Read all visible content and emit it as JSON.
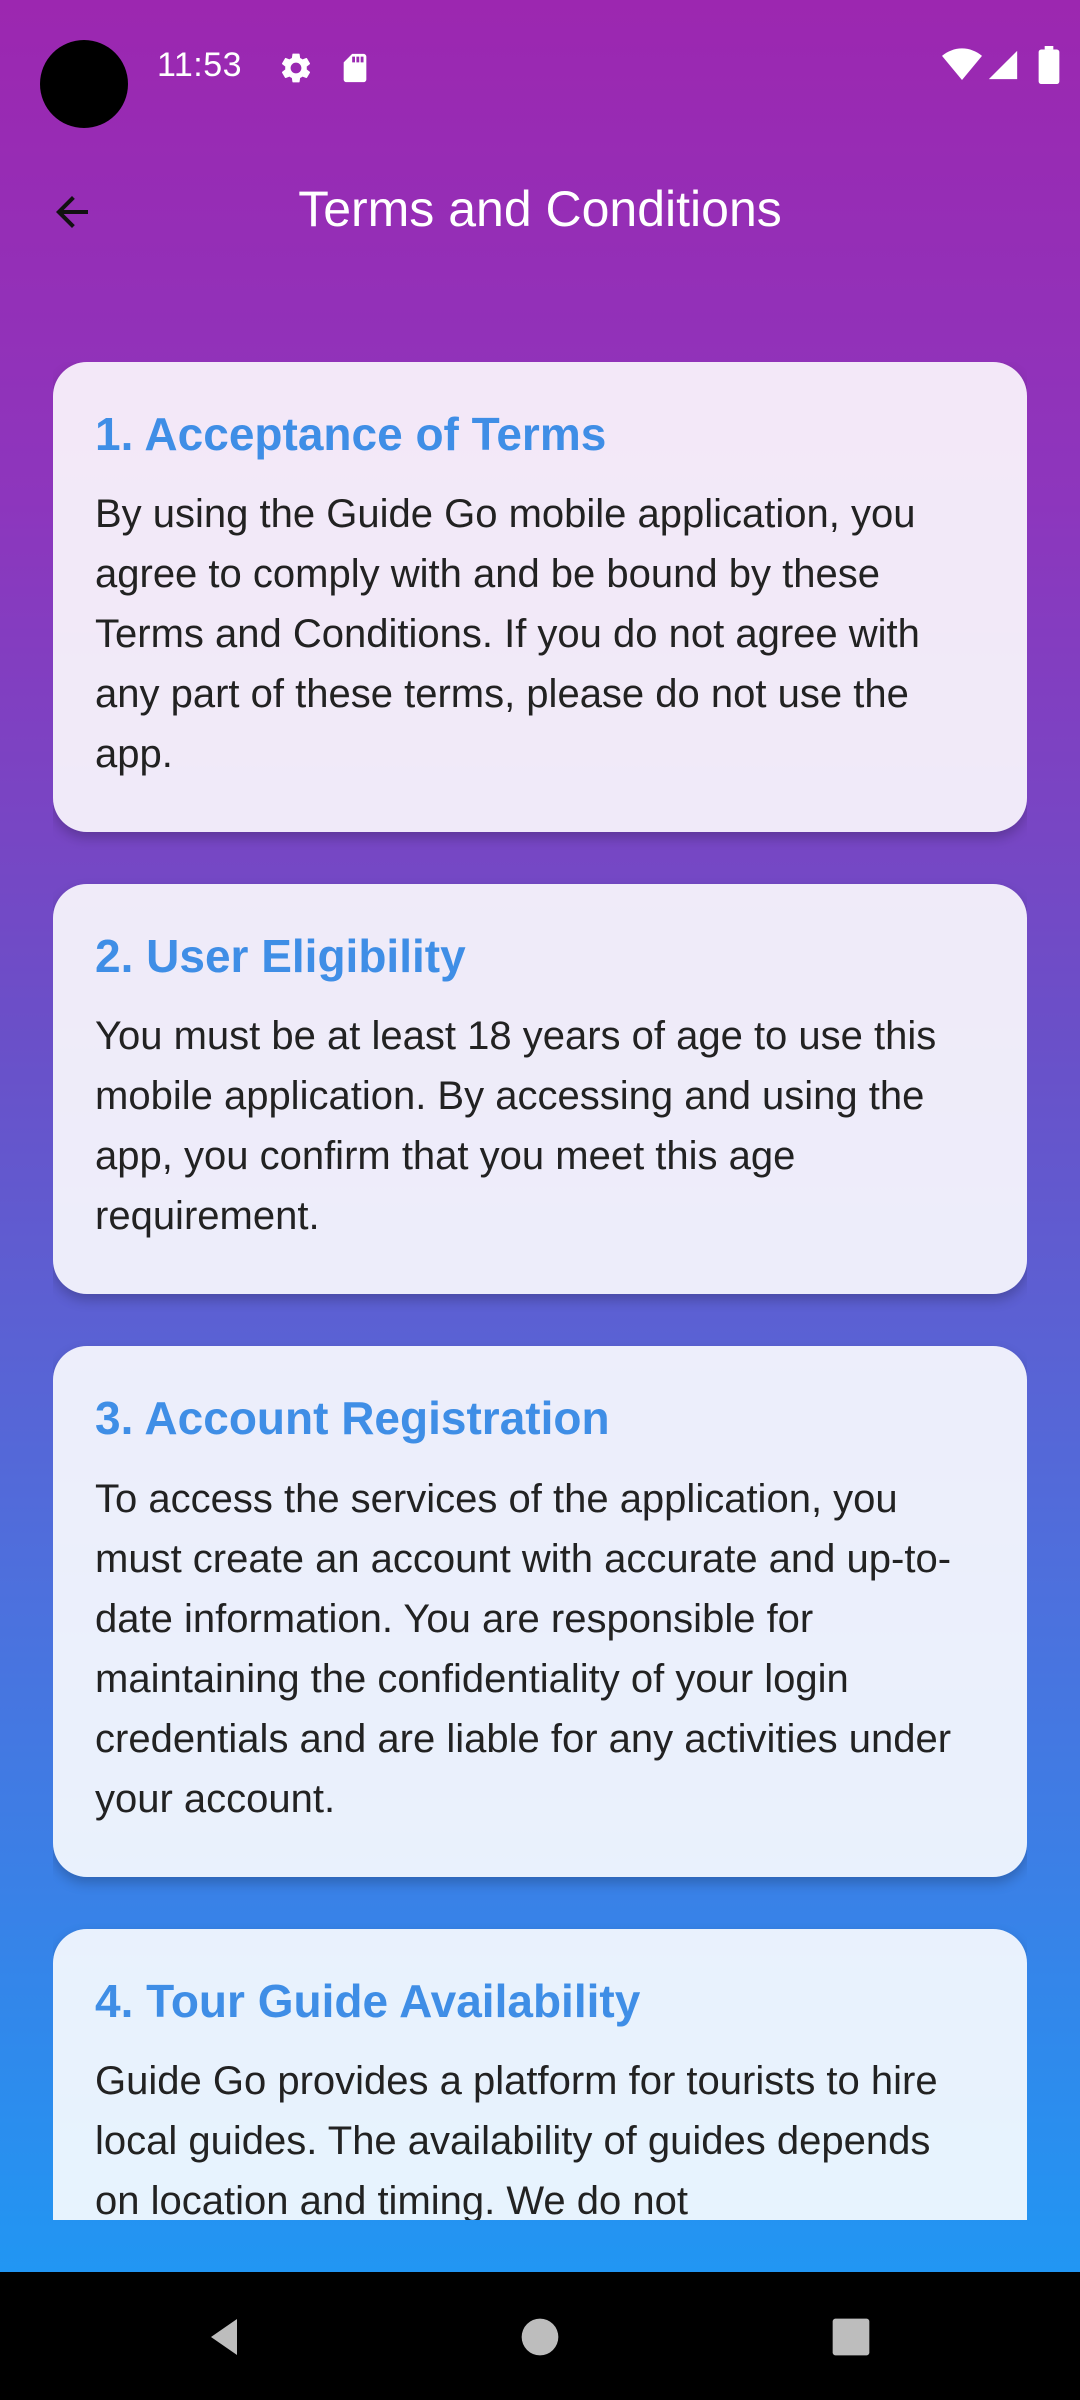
{
  "status_bar": {
    "time": "11:53",
    "icons": [
      "settings-icon",
      "sd-card-icon",
      "wifi-icon",
      "signal-icon",
      "battery-icon"
    ]
  },
  "app_bar": {
    "title": "Terms and Conditions",
    "back_icon": "arrow-back-icon"
  },
  "sections": [
    {
      "title": "1. Acceptance of Terms",
      "body": "By using the Guide Go mobile application, you agree to comply with and be bound by these Terms and Conditions. If you do not agree with any part of these terms, please do not use the app."
    },
    {
      "title": "2. User Eligibility",
      "body": "You must be at least 18 years of age to use this mobile application. By accessing and using the app, you confirm that you meet this age requirement."
    },
    {
      "title": "3. Account Registration",
      "body": "To access the services of the application, you must create an account with accurate and up-to-date information. You are responsible for maintaining the confidentiality of your login credentials and are liable for any activities under your account."
    },
    {
      "title": "4. Tour Guide Availability",
      "body": "Guide Go provides a platform for tourists to hire local guides. The availability of guides depends on location and timing. We do not"
    }
  ],
  "nav_bar": {
    "buttons": [
      "back-triangle-icon",
      "home-circle-icon",
      "recents-square-icon"
    ]
  },
  "colors": {
    "gradient_top": "#9c27b0",
    "gradient_bottom": "#2196f3",
    "section_title": "#3f8ee6",
    "body_text": "#222222"
  }
}
